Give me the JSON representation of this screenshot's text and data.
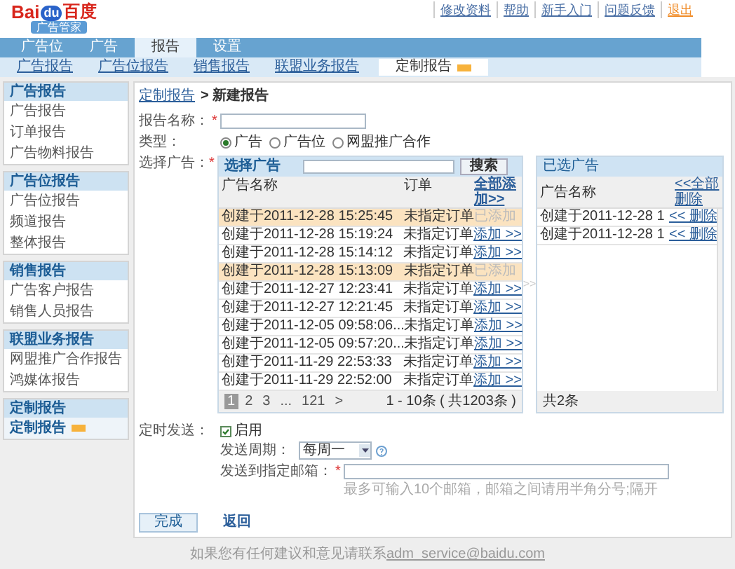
{
  "logo": {
    "brand_left": "Bai",
    "brand_paw": "du",
    "brand_right": "百度",
    "badge": "广告管家"
  },
  "top_links": [
    {
      "label": "修改资料",
      "kind": "link"
    },
    {
      "label": "帮助",
      "kind": "link"
    },
    {
      "label": "新手入门",
      "kind": "link"
    },
    {
      "label": "问题反馈",
      "kind": "link"
    },
    {
      "label": "退出",
      "kind": "exit"
    }
  ],
  "nav_tabs": [
    {
      "label": "广告位",
      "selected": false
    },
    {
      "label": "广告",
      "selected": false
    },
    {
      "label": "报告",
      "selected": true
    },
    {
      "label": "设置",
      "selected": false
    }
  ],
  "sub_tabs": [
    {
      "label": "广告报告",
      "selected": false,
      "badge": false
    },
    {
      "label": "广告位报告",
      "selected": false,
      "badge": false
    },
    {
      "label": "销售报告",
      "selected": false,
      "badge": false
    },
    {
      "label": "联盟业务报告",
      "selected": false,
      "badge": false
    },
    {
      "label": "定制报告",
      "selected": true,
      "badge": true
    }
  ],
  "sidebar": [
    {
      "title": "广告报告",
      "items": [
        {
          "label": "广告报告",
          "selected": false
        },
        {
          "label": "订单报告",
          "selected": false
        },
        {
          "label": "广告物料报告",
          "selected": false
        }
      ]
    },
    {
      "title": "广告位报告",
      "items": [
        {
          "label": "广告位报告",
          "selected": false
        },
        {
          "label": "频道报告",
          "selected": false
        },
        {
          "label": "整体报告",
          "selected": false
        }
      ]
    },
    {
      "title": "销售报告",
      "items": [
        {
          "label": "广告客户报告",
          "selected": false
        },
        {
          "label": "销售人员报告",
          "selected": false
        }
      ]
    },
    {
      "title": "联盟业务报告",
      "items": [
        {
          "label": "网盟推广合作报告",
          "selected": false
        },
        {
          "label": "鸿媒体报告",
          "selected": false
        }
      ]
    },
    {
      "title": "定制报告",
      "items": [
        {
          "label": "定制报告",
          "selected": true,
          "badge": true
        }
      ]
    }
  ],
  "breadcrumb": {
    "link": "定制报告",
    "current": "> 新建报告"
  },
  "form": {
    "name": {
      "label": "报告名称：",
      "required_mark": "*"
    },
    "type": {
      "label": "类型：",
      "options": [
        {
          "label": "广告",
          "selected": true
        },
        {
          "label": "广告位",
          "selected": false
        },
        {
          "label": "网盟推广合作",
          "selected": false
        }
      ]
    },
    "select": {
      "label": "选择广告：",
      "required_mark": "*"
    }
  },
  "ad_picker": {
    "title": "选择广告",
    "search_button": "搜索",
    "columns": [
      "广告名称",
      "订单",
      "全部添加>>"
    ],
    "rows": [
      {
        "name": "创建于2011-12-28 15:25:45",
        "order": "未指定订单",
        "added": true,
        "action": "已添加"
      },
      {
        "name": "创建于2011-12-28 15:19:24",
        "order": "未指定订单",
        "added": false,
        "action": "添加 >>"
      },
      {
        "name": "创建于2011-12-28 15:14:12",
        "order": "未指定订单",
        "added": false,
        "action": "添加 >>"
      },
      {
        "name": "创建于2011-12-28 15:13:09",
        "order": "未指定订单",
        "added": true,
        "action": "已添加"
      },
      {
        "name": "创建于2011-12-27 12:23:41",
        "order": "未指定订单",
        "added": false,
        "action": "添加 >>"
      },
      {
        "name": "创建于2011-12-27 12:21:45",
        "order": "未指定订单",
        "added": false,
        "action": "添加 >>"
      },
      {
        "name": "创建于2011-12-05 09:58:06...",
        "order": "未指定订单",
        "added": false,
        "action": "添加 >>"
      },
      {
        "name": "创建于2011-12-05 09:57:20...",
        "order": "未指定订单",
        "added": false,
        "action": "添加 >>"
      },
      {
        "name": "创建于2011-11-29 22:53:33",
        "order": "未指定订单",
        "added": false,
        "action": "添加 >>"
      },
      {
        "name": "创建于2011-11-29 22:52:00",
        "order": "未指定订单",
        "added": false,
        "action": "添加 >>"
      }
    ],
    "pages": [
      {
        "label": "1",
        "selected": true
      },
      {
        "label": "2",
        "selected": false
      },
      {
        "label": "3",
        "selected": false
      },
      {
        "label": "...",
        "selected": false
      },
      {
        "label": "121",
        "selected": false
      }
    ],
    "next": ">",
    "range": "1 - 10条 ( 共1203条 )"
  },
  "separator": ">>",
  "selected_ads": {
    "title": "已选广告",
    "columns": [
      "广告名称",
      "<<全部删除"
    ],
    "rows": [
      {
        "name": "创建于2011-12-28 1",
        "action": "<< 删除"
      },
      {
        "name": "创建于2011-12-28 1",
        "action": "<< 删除"
      }
    ],
    "total": "共2条"
  },
  "schedule": {
    "label": "定时发送：",
    "enabled_label": "启用",
    "checked": true,
    "period_label": "发送周期：",
    "period_value": "每周一",
    "email_label": "发送到指定邮箱：",
    "email_required_mark": "*",
    "email_hint": "最多可输入10个邮箱，邮箱之间请用半角分号;隔开"
  },
  "actions": {
    "submit": "完成",
    "back": "返回"
  },
  "footer": {
    "text": "如果您有任何建议和意见请联系",
    "email": "adm_service@baidu.com"
  }
}
